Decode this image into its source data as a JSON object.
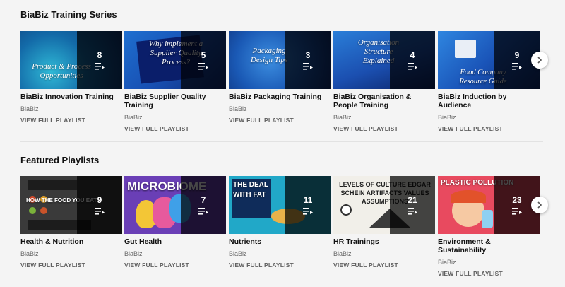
{
  "sections": [
    {
      "title": "BiaBiz Training Series",
      "playlists": [
        {
          "title": "BiaBiz Innovation Training",
          "channel": "BiaBiz",
          "count": "8",
          "link": "VIEW FULL PLAYLIST",
          "art": "Product & Process Opportunities"
        },
        {
          "title": "BiaBiz Supplier Quality Training",
          "channel": "BiaBiz",
          "count": "5",
          "link": "VIEW FULL PLAYLIST",
          "art": "Why implement a Supplier Quality Process?"
        },
        {
          "title": "BiaBiz Packaging Training",
          "channel": "BiaBiz",
          "count": "3",
          "link": "VIEW FULL PLAYLIST",
          "art": "Packaging Design Tips"
        },
        {
          "title": "BiaBiz Organisation & People Training",
          "channel": "BiaBiz",
          "count": "4",
          "link": "VIEW FULL PLAYLIST",
          "art": "Organisation Structure Explained"
        },
        {
          "title": "BiaBiz Induction by Audience",
          "channel": "BiaBiz",
          "count": "9",
          "link": "VIEW FULL PLAYLIST",
          "art": "Food Company Resource Guide"
        }
      ]
    },
    {
      "title": "Featured Playlists",
      "playlists": [
        {
          "title": "Health & Nutrition",
          "channel": "BiaBiz",
          "count": "9",
          "link": "VIEW FULL PLAYLIST",
          "art": "HOW THE FOOD YOU EAT AFFECTS YOUR BRAIN"
        },
        {
          "title": "Gut Health",
          "channel": "BiaBiz",
          "count": "7",
          "link": "VIEW FULL PLAYLIST",
          "art": "MICROBIOME"
        },
        {
          "title": "Nutrients",
          "channel": "BiaBiz",
          "count": "11",
          "link": "VIEW FULL PLAYLIST",
          "art": "THE DEAL WITH FAT"
        },
        {
          "title": "HR Trainings",
          "channel": "BiaBiz",
          "count": "21",
          "link": "VIEW FULL PLAYLIST",
          "art": "LEVELS OF CULTURE EDGAR SCHEIN ARTIFACTS VALUES ASSUMPTIONS"
        },
        {
          "title": "Environment & Sustainability",
          "channel": "BiaBiz",
          "count": "23",
          "link": "VIEW FULL PLAYLIST",
          "art": "PLASTIC POLLUTION"
        }
      ]
    }
  ],
  "icons": {
    "playlist": "playlist-icon",
    "next": "chevron-right-icon"
  },
  "colors": {
    "background": "#f4f4f4",
    "overlay": "#000000",
    "text": "#111111",
    "muted": "#666666"
  }
}
